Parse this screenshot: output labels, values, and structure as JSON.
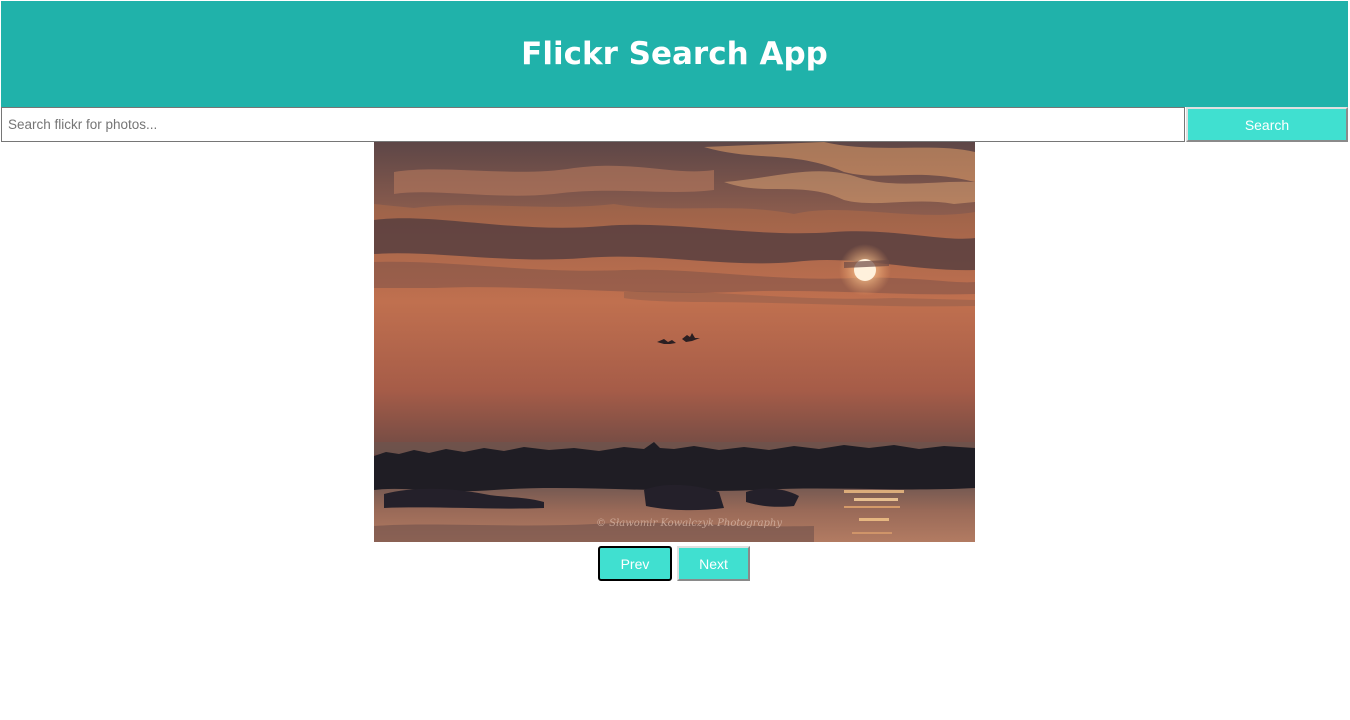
{
  "header": {
    "title": "Flickr Search App"
  },
  "search": {
    "placeholder": "Search flickr for photos...",
    "value": "",
    "button_label": "Search"
  },
  "photo": {
    "watermark": "© Sławomir Kowalczyk Photography"
  },
  "pagination": {
    "prev_label": "Prev",
    "next_label": "Next"
  },
  "colors": {
    "header_bg": "#20b2aa",
    "button_bg": "#40e0d0",
    "text_light": "#ffffff"
  }
}
